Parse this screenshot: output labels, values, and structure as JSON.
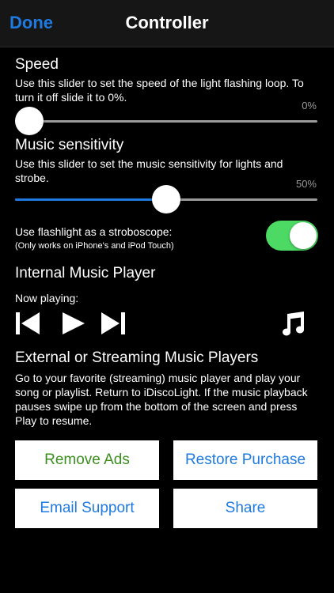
{
  "navbar": {
    "done_label": "Done",
    "title": "Controller"
  },
  "speed": {
    "title": "Speed",
    "description": "Use this slider to set the speed of the light flashing loop. To turn it off slide it to 0%.",
    "value_label": "0%",
    "value_percent": 0
  },
  "sensitivity": {
    "title": "Music sensitivity",
    "description": "Use this slider to set the music sensitivity for lights and strobe.",
    "value_label": "50%",
    "value_percent": 50
  },
  "flashlight": {
    "label": "Use flashlight as a stroboscope:",
    "sublabel": "(Only works on iPhone's and iPod Touch)",
    "enabled": true
  },
  "internal_player": {
    "title": "Internal Music Player",
    "now_playing_label": "Now playing:",
    "icons": [
      "skip-previous-icon",
      "play-icon",
      "skip-next-icon",
      "music-note-icon"
    ]
  },
  "external_players": {
    "title": "External or Streaming Music Players",
    "description": "Go to your favorite (streaming) music player and play your song or playlist. Return to iDiscoLight. If the music playback pauses swipe up from the bottom of the screen and press Play to resume."
  },
  "buttons": {
    "remove_ads": "Remove Ads",
    "restore_purchase": "Restore Purchase",
    "email_support": "Email Support",
    "share": "Share"
  },
  "colors": {
    "accent_blue": "#1f7ae0",
    "remove_ads_green": "#3a8f1f",
    "toggle_on": "#4cd964",
    "background": "#000000",
    "navbar": "#161616"
  }
}
